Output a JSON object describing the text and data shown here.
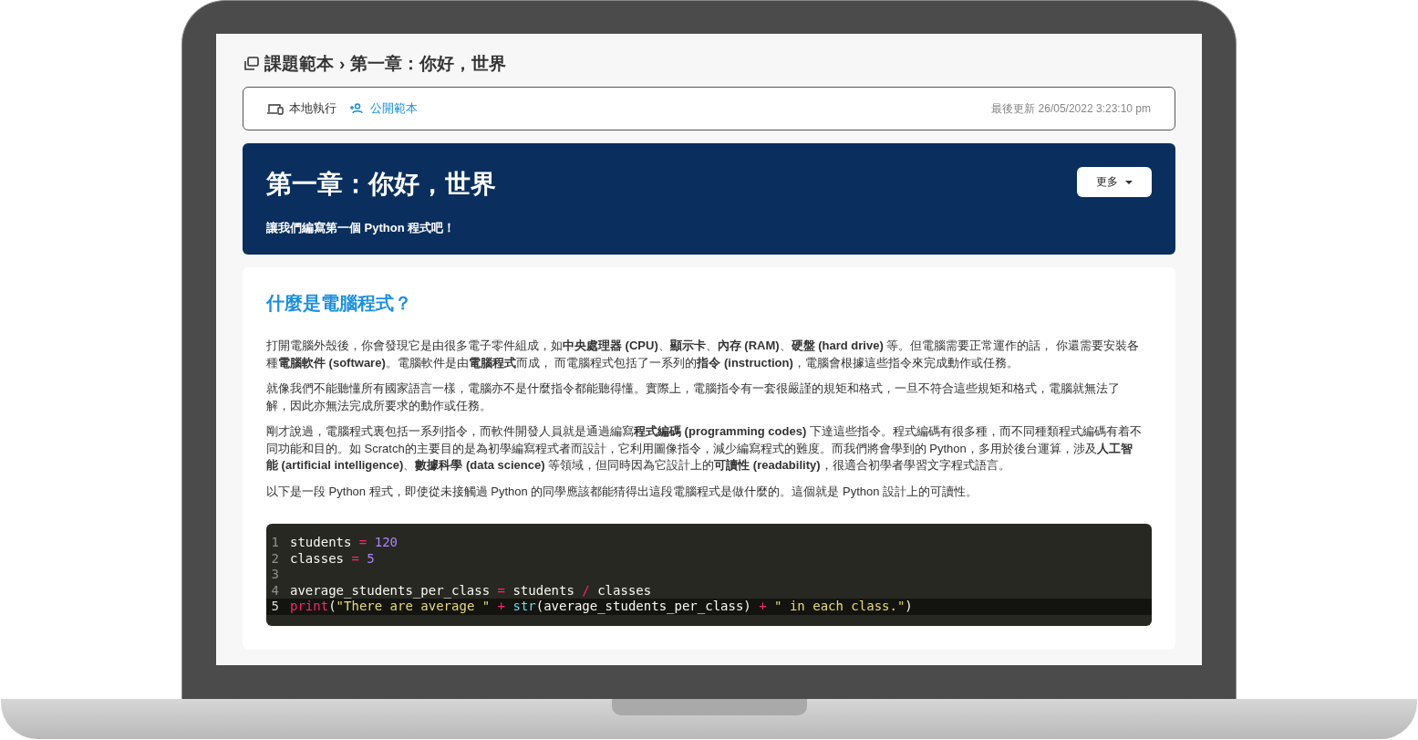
{
  "breadcrumb": {
    "parent": "課題範本",
    "separator": "›",
    "current": "第一章：你好，世界"
  },
  "info_bar": {
    "actions": [
      {
        "kind": "local",
        "label": "本地執行"
      },
      {
        "kind": "public",
        "label": "公開範本"
      }
    ],
    "updated": "最後更新 26/05/2022 3:23:10 pm"
  },
  "banner": {
    "title": "第一章：你好，世界",
    "subtitle": "讓我們編寫第一個 Python 程式吧！",
    "more_button": "更多"
  },
  "article": {
    "heading": "什麼是電腦程式？",
    "paragraphs": [
      "打開電腦外殼後，你會發現它是由很多電子零件組成，如**中央處理器 (CPU)**、**顯示卡**、**內存 (RAM)**、**硬盤 (hard drive)** 等。但電腦需要正常運作的話， 你還需要安裝各種**電腦軟件 (software)**。電腦軟件是由**電腦程式**而成， 而電腦程式包括了一系列的**指令 (instruction)**，電腦會根據這些指令來完成動作或任務。",
      "就像我們不能聽懂所有國家語言一樣，電腦亦不是什麼指令都能聽得懂。實際上，電腦指令有一套很嚴謹的規矩和格式，一旦不符合這些規矩和格式，電腦就無法了解，因此亦無法完成所要求的動作或任務。",
      "剛才說過，電腦程式裏包括一系列指令，而軟件開發人員就是通過編寫**程式編碼 (programming codes)** 下達這些指令。程式編碼有很多種，而不同種類程式編碼有着不同功能和目的。如 Scratch的主要目的是為初學編寫程式者而設計，它利用圖像指令，減少編寫程式的難度。而我們將會學到的 Python，多用於後台運算，涉及**人工智能 (artificial intelligence)**、**數據科學 (data science)** 等領域，但同時因為它設計上的**可讀性 (readability)**，很適合初學者學習文字程式語言。",
      "以下是一段 Python 程式，即使從未接觸過 Python 的同學應該都能猜得出這段電腦程式是做什麼的。這個就是 Python 設計上的可讀性。"
    ],
    "code": [
      {
        "number": "1",
        "active": false,
        "tokens": [
          {
            "kind": "name",
            "text": "students "
          },
          {
            "kind": "op",
            "text": "="
          },
          {
            "kind": "num",
            "text": " 120"
          }
        ]
      },
      {
        "number": "2",
        "active": false,
        "tokens": [
          {
            "kind": "name",
            "text": "classes "
          },
          {
            "kind": "op",
            "text": "="
          },
          {
            "kind": "num",
            "text": " 5"
          }
        ]
      },
      {
        "number": "3",
        "active": false
      },
      {
        "number": "4",
        "active": false,
        "tokens": [
          {
            "kind": "name",
            "text": "average_students_per_class "
          },
          {
            "kind": "op",
            "text": "="
          },
          {
            "kind": "name",
            "text": " students "
          },
          {
            "kind": "op",
            "text": "/"
          },
          {
            "kind": "name",
            "text": " classes"
          }
        ]
      },
      {
        "number": "5",
        "active": true,
        "tokens": [
          {
            "kind": "keyword",
            "text": "print"
          },
          {
            "kind": "name",
            "text": "("
          },
          {
            "kind": "str",
            "text": "\"There are average \""
          },
          {
            "kind": "op",
            "text": " + "
          },
          {
            "kind": "func",
            "text": "str"
          },
          {
            "kind": "name",
            "text": "(average_students_per_class) "
          },
          {
            "kind": "op",
            "text": "+"
          },
          {
            "kind": "str",
            "text": " \" in each class.\""
          },
          {
            "kind": "name",
            "text": ")"
          }
        ]
      }
    ]
  }
}
